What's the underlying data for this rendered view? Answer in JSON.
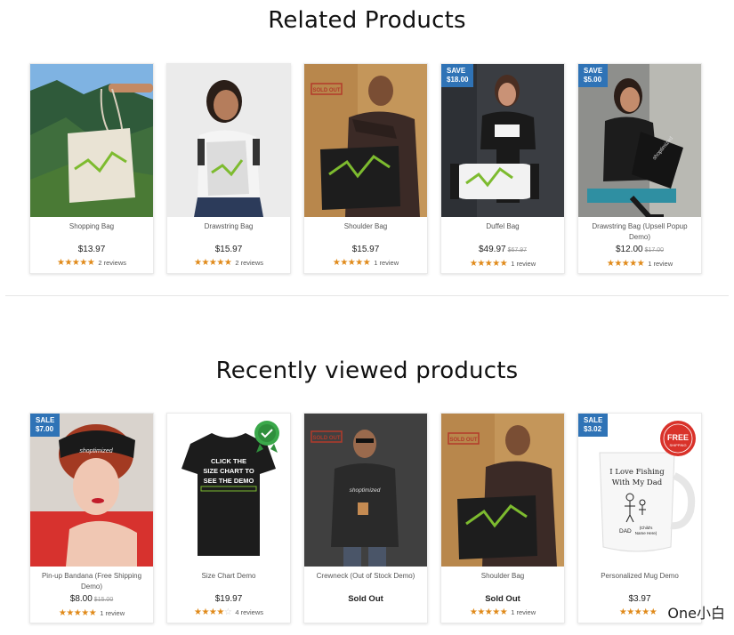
{
  "related": {
    "title": "Related Products",
    "products": [
      {
        "name": "Shopping Bag",
        "price": "$13.97",
        "old_price": "",
        "badge": null,
        "stars": 5,
        "reviews": "2 reviews",
        "image": "tote-bag-on-mountain"
      },
      {
        "name": "Drawstring Bag",
        "price": "$15.97",
        "old_price": "",
        "badge": null,
        "stars": 5,
        "reviews": "2 reviews",
        "image": "woman-with-drawstring-bag"
      },
      {
        "name": "Shoulder Bag",
        "price": "$15.97",
        "old_price": "",
        "badge": null,
        "stars": 5,
        "reviews": "1 review",
        "image": "man-with-shoulder-bag"
      },
      {
        "name": "Duffel Bag",
        "price": "$49.97",
        "old_price": "$67.97",
        "badge": {
          "label": "SAVE",
          "amount": "$18.00"
        },
        "stars": 5,
        "reviews": "1 review",
        "image": "woman-with-duffel-bag"
      },
      {
        "name": "Drawstring Bag (Upsell Popup Demo)",
        "price": "$12.00",
        "old_price": "$17.00",
        "badge": {
          "label": "SAVE",
          "amount": "$5.00"
        },
        "stars": 5,
        "reviews": "1 review",
        "image": "woman-seated-with-bag"
      }
    ]
  },
  "recent": {
    "title": "Recently viewed products",
    "products": [
      {
        "name": "Pin-up Bandana (Free Shipping Demo)",
        "price": "$8.00",
        "old_price": "$15.00",
        "badge": {
          "label": "SALE",
          "amount": "$7.00"
        },
        "stars": 5,
        "reviews": "1 review",
        "image": "woman-with-bandana"
      },
      {
        "name": "Size Chart Demo",
        "price": "$19.97",
        "old_price": "",
        "badge": null,
        "stars": 4,
        "reviews": "4 reviews",
        "image": "black-tshirt-size-chart"
      },
      {
        "name": "Crewneck (Out of Stock Demo)",
        "price": "",
        "sold_out": "Sold Out",
        "old_price": "",
        "badge": null,
        "stars": 0,
        "reviews": "",
        "image": "man-in-crewneck"
      },
      {
        "name": "Shoulder Bag",
        "price": "",
        "sold_out": "Sold Out",
        "old_price": "",
        "badge": null,
        "stars": 5,
        "reviews": "1 review",
        "image": "man-with-shoulder-bag"
      },
      {
        "name": "Personalized Mug Demo",
        "price": "$3.97",
        "old_price": "",
        "badge": {
          "label": "SALE",
          "amount": "$3.02"
        },
        "stars": 5,
        "reviews": "",
        "image": "personalized-mug"
      }
    ]
  },
  "image_text": {
    "tshirt_line1": "CLICK THE",
    "tshirt_line2": "SIZE CHART TO",
    "tshirt_line3": "SEE THE DEMO",
    "mug_line1": "I Love Fishing",
    "mug_line2": "With My Dad",
    "mug_line3": "DAD",
    "mug_line4": "(Child's",
    "mug_line5": "Name Here)",
    "free_line1": "FREE",
    "free_line2": "SHIPPING",
    "sold_stamp": "SOLD OUT",
    "bandana_brand": "shoptimized",
    "crewneck_brand": "shoptimized",
    "bag_brand": "shoptimized"
  },
  "watermark": "One小白",
  "colors": {
    "badge": "#2f73b6",
    "star": "#e08a1a",
    "accent_green": "#7dbb2f"
  }
}
